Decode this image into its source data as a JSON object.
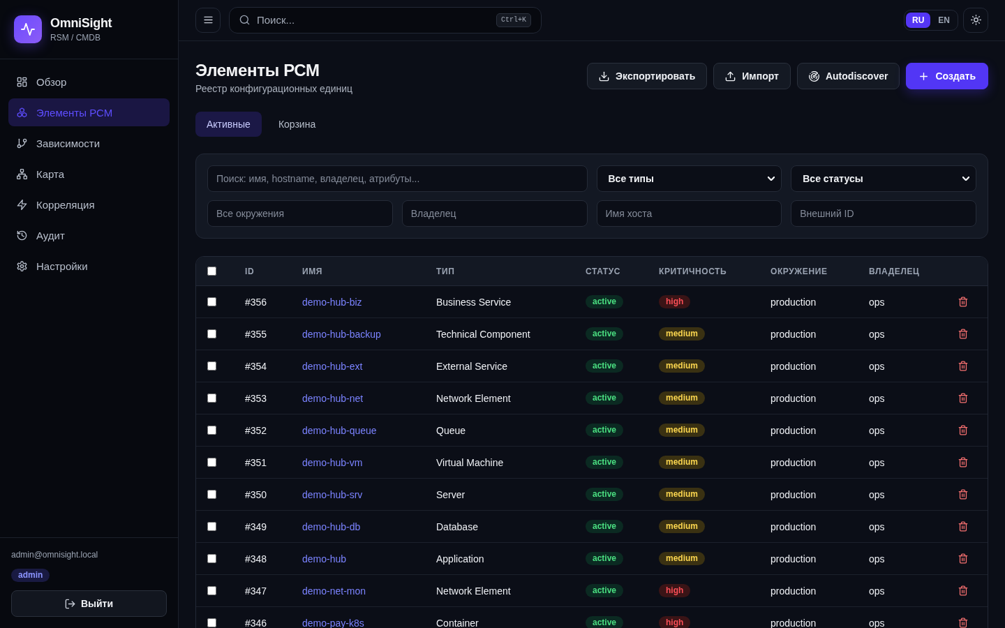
{
  "sidebar": {
    "brand": {
      "name": "OmniSight",
      "subtitle": "RSM / CMDB"
    },
    "nav": [
      {
        "label": "Обзор",
        "selected": false
      },
      {
        "label": "Элементы РСМ",
        "selected": true
      },
      {
        "label": "Зависимости",
        "selected": false
      },
      {
        "label": "Карта",
        "selected": false
      },
      {
        "label": "Корреляция",
        "selected": false
      },
      {
        "label": "Аудит",
        "selected": false
      },
      {
        "label": "Настройки",
        "selected": false
      }
    ],
    "user": {
      "email": "admin@omnisight.local",
      "role": "admin"
    },
    "logout": {
      "label": "Выйти"
    }
  },
  "topbar": {
    "search": {
      "placeholder": "Поиск...",
      "shortcut": "Ctrl+K"
    },
    "languages": [
      {
        "label": "RU",
        "selected": true
      },
      {
        "label": "EN",
        "selected": false
      }
    ]
  },
  "page": {
    "title": "Элементы РСМ",
    "subtitle": "Реестр конфигурационных единиц",
    "actions": [
      {
        "label": "Экспортировать",
        "kind": "secondary"
      },
      {
        "label": "Импорт",
        "kind": "secondary"
      },
      {
        "label": "Autodiscover",
        "kind": "secondary"
      },
      {
        "label": "Создать",
        "kind": "primary"
      }
    ]
  },
  "tabs": [
    {
      "label": "Активные",
      "selected": true
    },
    {
      "label": "Корзина",
      "selected": false
    }
  ],
  "filters": {
    "search": {
      "placeholder": "Поиск: имя, hostname, владелец, атрибуты..."
    },
    "type": {
      "value": "Все типы"
    },
    "status": {
      "value": "Все статусы"
    },
    "environment": {
      "placeholder": "Все окружения"
    },
    "owner": {
      "placeholder": "Владелец"
    },
    "hostname": {
      "placeholder": "Имя хоста"
    },
    "external_id": {
      "placeholder": "Внешний ID"
    }
  },
  "table": {
    "select_all": {
      "checked": false
    },
    "columns": [
      "ID",
      "ИМЯ",
      "ТИП",
      "СТАТУС",
      "КРИТИЧНОСТЬ",
      "ОКРУЖЕНИЕ",
      "ВЛАДЕЛЕЦ"
    ],
    "rows": [
      {
        "checked": false,
        "id": "#356",
        "name": "demo-hub-biz",
        "type": "Business Service",
        "status": "active",
        "criticality": {
          "label": "high",
          "color": "#3a1416"
        },
        "environment": "production",
        "owner": "ops"
      },
      {
        "checked": false,
        "id": "#355",
        "name": "demo-hub-backup",
        "type": "Technical Component",
        "status": "active",
        "criticality": {
          "label": "medium",
          "color": "#3a3112"
        },
        "environment": "production",
        "owner": "ops"
      },
      {
        "checked": false,
        "id": "#354",
        "name": "demo-hub-ext",
        "type": "External Service",
        "status": "active",
        "criticality": {
          "label": "medium",
          "color": "#3a3112"
        },
        "environment": "production",
        "owner": "ops"
      },
      {
        "checked": false,
        "id": "#353",
        "name": "demo-hub-net",
        "type": "Network Element",
        "status": "active",
        "criticality": {
          "label": "medium",
          "color": "#3a3112"
        },
        "environment": "production",
        "owner": "ops"
      },
      {
        "checked": false,
        "id": "#352",
        "name": "demo-hub-queue",
        "type": "Queue",
        "status": "active",
        "criticality": {
          "label": "medium",
          "color": "#3a3112"
        },
        "environment": "production",
        "owner": "ops"
      },
      {
        "checked": false,
        "id": "#351",
        "name": "demo-hub-vm",
        "type": "Virtual Machine",
        "status": "active",
        "criticality": {
          "label": "medium",
          "color": "#3a3112"
        },
        "environment": "production",
        "owner": "ops"
      },
      {
        "checked": false,
        "id": "#350",
        "name": "demo-hub-srv",
        "type": "Server",
        "status": "active",
        "criticality": {
          "label": "medium",
          "color": "#3a3112"
        },
        "environment": "production",
        "owner": "ops"
      },
      {
        "checked": false,
        "id": "#349",
        "name": "demo-hub-db",
        "type": "Database",
        "status": "active",
        "criticality": {
          "label": "medium",
          "color": "#3a3112"
        },
        "environment": "production",
        "owner": "ops"
      },
      {
        "checked": false,
        "id": "#348",
        "name": "demo-hub",
        "type": "Application",
        "status": "active",
        "criticality": {
          "label": "medium",
          "color": "#3a3112"
        },
        "environment": "production",
        "owner": "ops"
      },
      {
        "checked": false,
        "id": "#347",
        "name": "demo-net-mon",
        "type": "Network Element",
        "status": "active",
        "criticality": {
          "label": "high",
          "color": "#3a1416"
        },
        "environment": "production",
        "owner": "ops"
      },
      {
        "checked": false,
        "id": "#346",
        "name": "demo-pay-k8s",
        "type": "Container",
        "status": "active",
        "criticality": {
          "label": "high",
          "color": "#3a1416"
        },
        "environment": "production",
        "owner": "ops"
      }
    ]
  }
}
